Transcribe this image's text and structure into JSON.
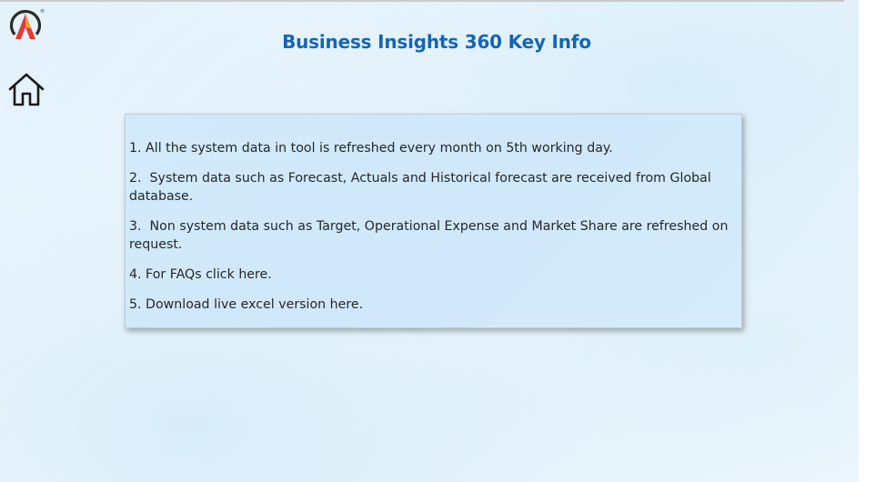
{
  "app": {
    "title": "Business Insights 360 Key Info"
  },
  "icons": {
    "logo": "brand-a-logo-icon",
    "home": "home-icon"
  },
  "colors": {
    "title": "#1565b5",
    "logo_red": "#e53935",
    "logo_orange": "#f39c3c",
    "logo_dark": "#2b2b2b",
    "card_background": "#d2ebfb"
  },
  "info": {
    "items": [
      "1. All the system data in tool is refreshed every month on 5th working day.",
      "2.  System data such as Forecast, Actuals and Historical forecast are received from Global database.",
      "3.  Non system data such as Target, Operational Expense and Market Share are refreshed on request.",
      "4. For FAQs click here.",
      "5. Download live excel version here."
    ]
  }
}
